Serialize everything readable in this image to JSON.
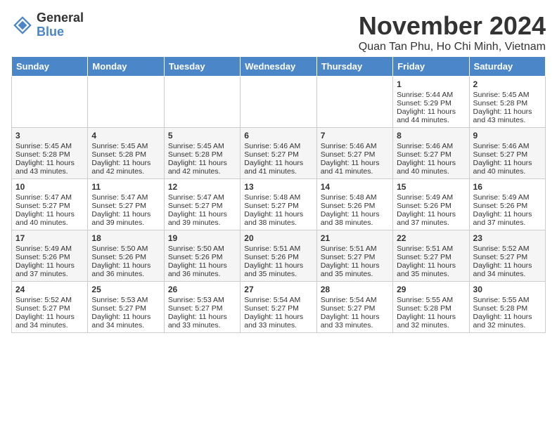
{
  "header": {
    "logo_general": "General",
    "logo_blue": "Blue",
    "month_title": "November 2024",
    "location": "Quan Tan Phu, Ho Chi Minh, Vietnam"
  },
  "days_of_week": [
    "Sunday",
    "Monday",
    "Tuesday",
    "Wednesday",
    "Thursday",
    "Friday",
    "Saturday"
  ],
  "weeks": [
    [
      {
        "day": "",
        "info": ""
      },
      {
        "day": "",
        "info": ""
      },
      {
        "day": "",
        "info": ""
      },
      {
        "day": "",
        "info": ""
      },
      {
        "day": "",
        "info": ""
      },
      {
        "day": "1",
        "info": "Sunrise: 5:44 AM\nSunset: 5:29 PM\nDaylight: 11 hours and 44 minutes."
      },
      {
        "day": "2",
        "info": "Sunrise: 5:45 AM\nSunset: 5:28 PM\nDaylight: 11 hours and 43 minutes."
      }
    ],
    [
      {
        "day": "3",
        "info": "Sunrise: 5:45 AM\nSunset: 5:28 PM\nDaylight: 11 hours and 43 minutes."
      },
      {
        "day": "4",
        "info": "Sunrise: 5:45 AM\nSunset: 5:28 PM\nDaylight: 11 hours and 42 minutes."
      },
      {
        "day": "5",
        "info": "Sunrise: 5:45 AM\nSunset: 5:28 PM\nDaylight: 11 hours and 42 minutes."
      },
      {
        "day": "6",
        "info": "Sunrise: 5:46 AM\nSunset: 5:27 PM\nDaylight: 11 hours and 41 minutes."
      },
      {
        "day": "7",
        "info": "Sunrise: 5:46 AM\nSunset: 5:27 PM\nDaylight: 11 hours and 41 minutes."
      },
      {
        "day": "8",
        "info": "Sunrise: 5:46 AM\nSunset: 5:27 PM\nDaylight: 11 hours and 40 minutes."
      },
      {
        "day": "9",
        "info": "Sunrise: 5:46 AM\nSunset: 5:27 PM\nDaylight: 11 hours and 40 minutes."
      }
    ],
    [
      {
        "day": "10",
        "info": "Sunrise: 5:47 AM\nSunset: 5:27 PM\nDaylight: 11 hours and 40 minutes."
      },
      {
        "day": "11",
        "info": "Sunrise: 5:47 AM\nSunset: 5:27 PM\nDaylight: 11 hours and 39 minutes."
      },
      {
        "day": "12",
        "info": "Sunrise: 5:47 AM\nSunset: 5:27 PM\nDaylight: 11 hours and 39 minutes."
      },
      {
        "day": "13",
        "info": "Sunrise: 5:48 AM\nSunset: 5:27 PM\nDaylight: 11 hours and 38 minutes."
      },
      {
        "day": "14",
        "info": "Sunrise: 5:48 AM\nSunset: 5:26 PM\nDaylight: 11 hours and 38 minutes."
      },
      {
        "day": "15",
        "info": "Sunrise: 5:49 AM\nSunset: 5:26 PM\nDaylight: 11 hours and 37 minutes."
      },
      {
        "day": "16",
        "info": "Sunrise: 5:49 AM\nSunset: 5:26 PM\nDaylight: 11 hours and 37 minutes."
      }
    ],
    [
      {
        "day": "17",
        "info": "Sunrise: 5:49 AM\nSunset: 5:26 PM\nDaylight: 11 hours and 37 minutes."
      },
      {
        "day": "18",
        "info": "Sunrise: 5:50 AM\nSunset: 5:26 PM\nDaylight: 11 hours and 36 minutes."
      },
      {
        "day": "19",
        "info": "Sunrise: 5:50 AM\nSunset: 5:26 PM\nDaylight: 11 hours and 36 minutes."
      },
      {
        "day": "20",
        "info": "Sunrise: 5:51 AM\nSunset: 5:26 PM\nDaylight: 11 hours and 35 minutes."
      },
      {
        "day": "21",
        "info": "Sunrise: 5:51 AM\nSunset: 5:27 PM\nDaylight: 11 hours and 35 minutes."
      },
      {
        "day": "22",
        "info": "Sunrise: 5:51 AM\nSunset: 5:27 PM\nDaylight: 11 hours and 35 minutes."
      },
      {
        "day": "23",
        "info": "Sunrise: 5:52 AM\nSunset: 5:27 PM\nDaylight: 11 hours and 34 minutes."
      }
    ],
    [
      {
        "day": "24",
        "info": "Sunrise: 5:52 AM\nSunset: 5:27 PM\nDaylight: 11 hours and 34 minutes."
      },
      {
        "day": "25",
        "info": "Sunrise: 5:53 AM\nSunset: 5:27 PM\nDaylight: 11 hours and 34 minutes."
      },
      {
        "day": "26",
        "info": "Sunrise: 5:53 AM\nSunset: 5:27 PM\nDaylight: 11 hours and 33 minutes."
      },
      {
        "day": "27",
        "info": "Sunrise: 5:54 AM\nSunset: 5:27 PM\nDaylight: 11 hours and 33 minutes."
      },
      {
        "day": "28",
        "info": "Sunrise: 5:54 AM\nSunset: 5:27 PM\nDaylight: 11 hours and 33 minutes."
      },
      {
        "day": "29",
        "info": "Sunrise: 5:55 AM\nSunset: 5:28 PM\nDaylight: 11 hours and 32 minutes."
      },
      {
        "day": "30",
        "info": "Sunrise: 5:55 AM\nSunset: 5:28 PM\nDaylight: 11 hours and 32 minutes."
      }
    ]
  ]
}
